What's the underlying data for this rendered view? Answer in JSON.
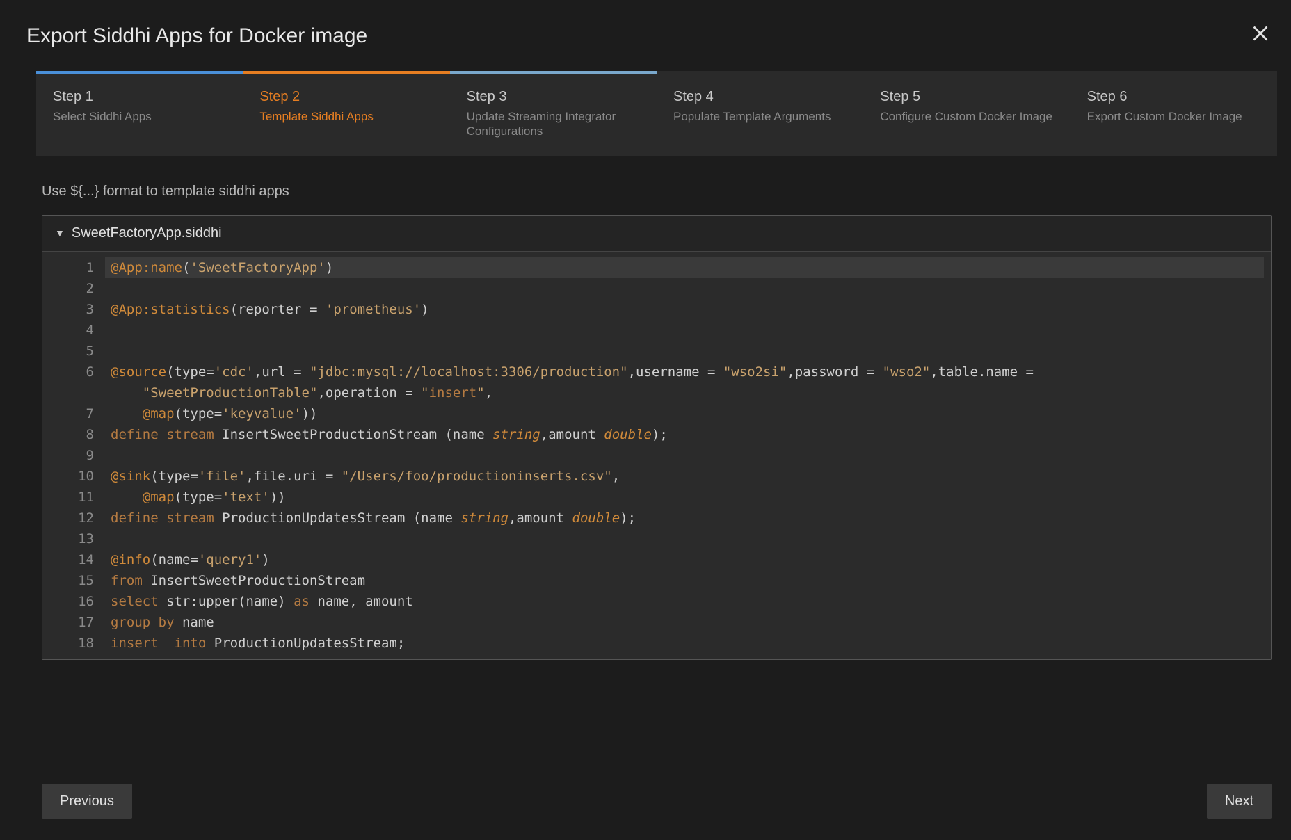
{
  "modal": {
    "title": "Export Siddhi Apps for Docker image"
  },
  "steps": [
    {
      "title": "Step 1",
      "sub": "Select Siddhi Apps"
    },
    {
      "title": "Step 2",
      "sub": "Template Siddhi Apps"
    },
    {
      "title": "Step 3",
      "sub": "Update Streaming Integrator Configurations"
    },
    {
      "title": "Step 4",
      "sub": "Populate Template Arguments"
    },
    {
      "title": "Step 5",
      "sub": "Configure Custom Docker Image"
    },
    {
      "title": "Step 6",
      "sub": "Export Custom Docker Image"
    }
  ],
  "instruction": "Use ${...} format to template siddhi apps",
  "file": {
    "name": "SweetFactoryApp.siddhi"
  },
  "code_lines": [
    "@App:name('SweetFactoryApp')",
    "",
    "@App:statistics(reporter = 'prometheus')",
    "",
    "",
    "@source(type='cdc',url = \"jdbc:mysql://localhost:3306/production\",username = \"wso2si\",password = \"wso2\",table.name = \"SweetProductionTable\",operation = \"insert\",",
    "    @map(type='keyvalue'))",
    "define stream InsertSweetProductionStream (name string,amount double);",
    "",
    "@sink(type='file',file.uri = \"/Users/foo/productioninserts.csv\",",
    "    @map(type='text'))",
    "define stream ProductionUpdatesStream (name string,amount double);",
    "",
    "@info(name='query1')",
    "from InsertSweetProductionStream",
    "select str:upper(name) as name, amount",
    "group by name",
    "insert  into ProductionUpdatesStream;"
  ],
  "buttons": {
    "prev": "Previous",
    "next": "Next"
  }
}
